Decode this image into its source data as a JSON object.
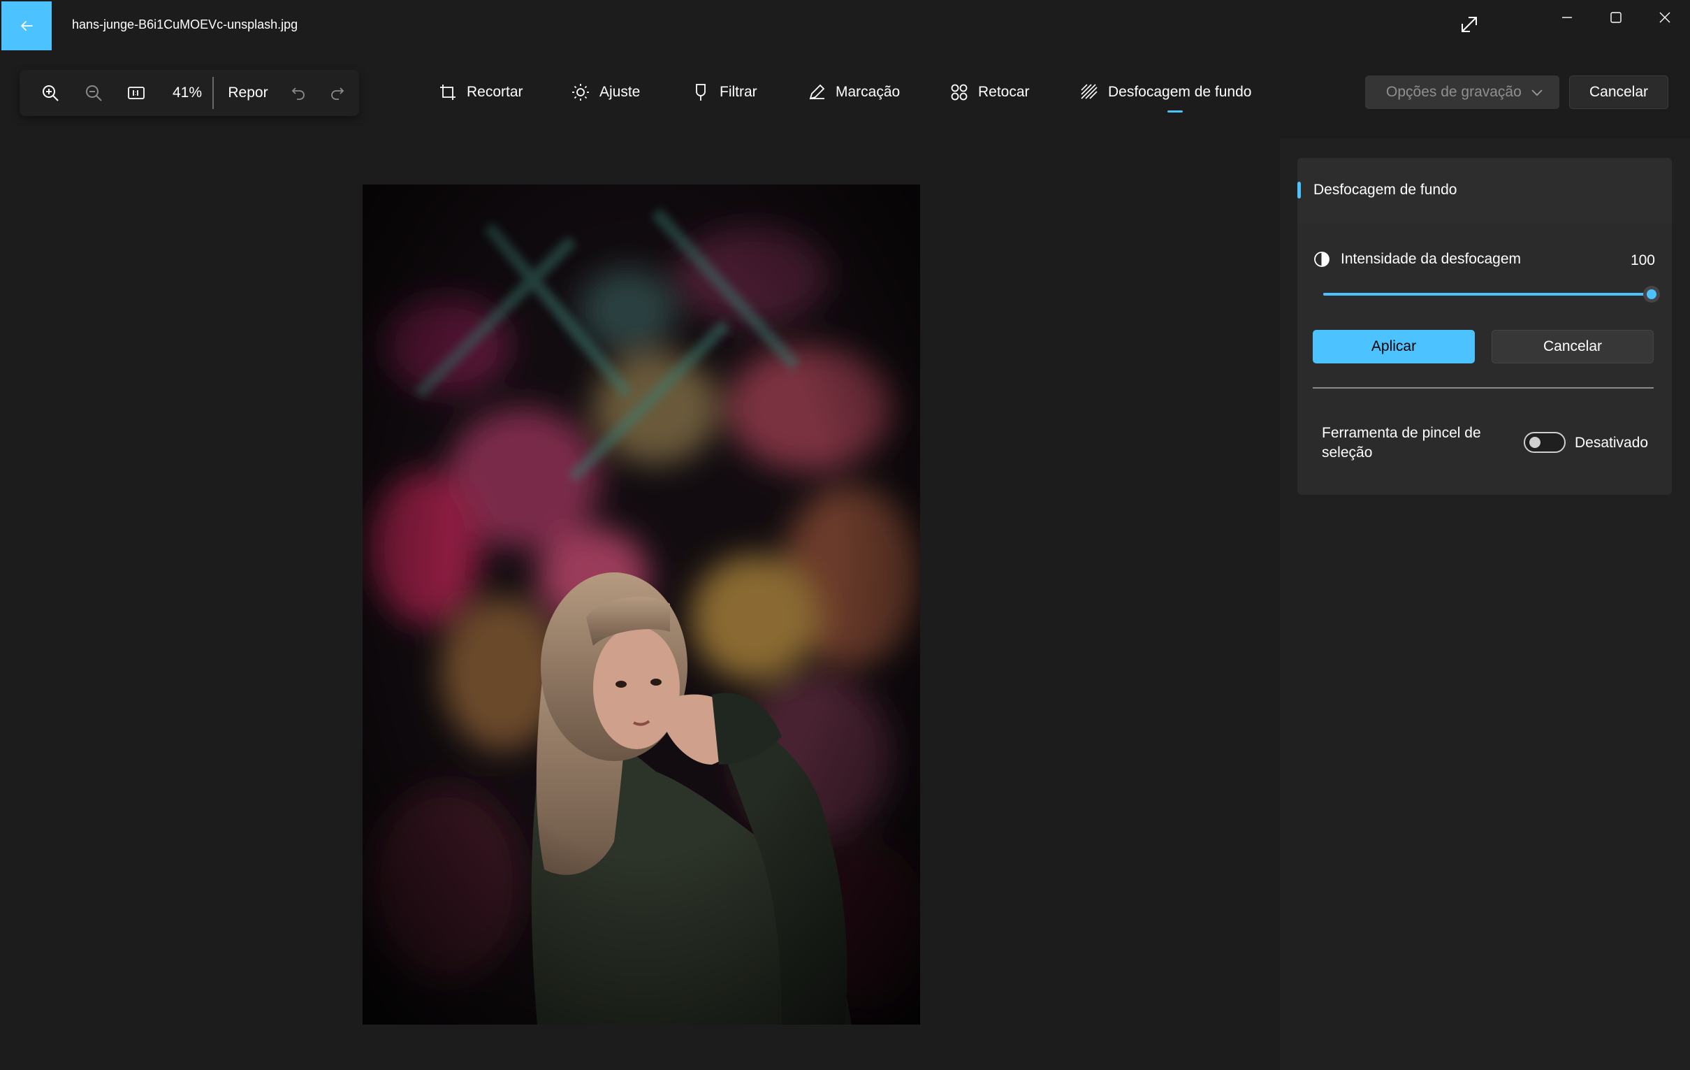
{
  "window": {
    "filename": "hans-junge-B6i1CuMOEVc-unsplash.jpg"
  },
  "zoom": {
    "level": "41%",
    "reset_label": "Repor"
  },
  "tabs": [
    {
      "label": "Recortar",
      "icon": "crop-icon"
    },
    {
      "label": "Ajuste",
      "icon": "brightness-icon"
    },
    {
      "label": "Filtrar",
      "icon": "filter-icon"
    },
    {
      "label": "Marcação",
      "icon": "markup-pen-icon"
    },
    {
      "label": "Retocar",
      "icon": "retouch-icon"
    },
    {
      "label": "Desfocagem de fundo",
      "icon": "background-blur-icon",
      "selected": true
    }
  ],
  "actions": {
    "save_options_label": "Opções de gravação",
    "cancel_label": "Cancelar"
  },
  "panel": {
    "title": "Desfocagem de fundo",
    "intensity_label": "Intensidade da desfocagem",
    "intensity_value": "100",
    "intensity_fraction": 1.0,
    "apply_label": "Aplicar",
    "cancel_label": "Cancelar",
    "brush_tool_label": "Ferramenta de pincel de seleção",
    "brush_tool_state": "Desativado"
  },
  "colors": {
    "accent": "#4cc2ff",
    "background": "#1c1c1c",
    "panel": "#2b2b2b"
  }
}
